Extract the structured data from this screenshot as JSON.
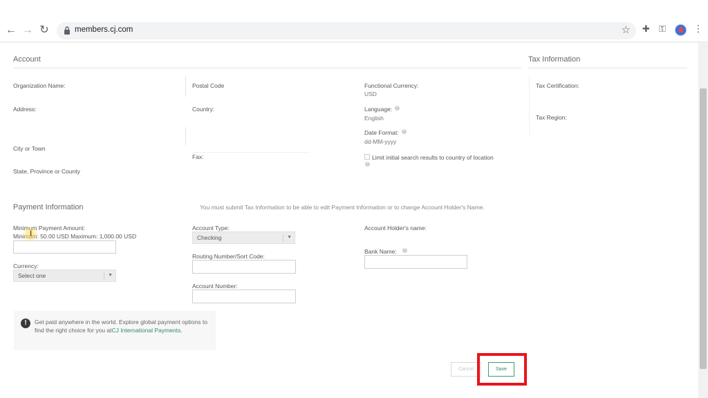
{
  "browser": {
    "url": "members.cj.com"
  },
  "account": {
    "title": "Account",
    "organization_name_label": "Organization Name:",
    "address_label": "Address:",
    "city_label": "City or Town",
    "state_label": "State, Province or County",
    "postal_code_label": "Postal Code",
    "country_label": "Country:",
    "fax_label": "Fax:",
    "functional_currency_label": "Functional Currency:",
    "functional_currency_value": "USD",
    "language_label": "Language:",
    "language_value": "English",
    "date_format_label": "Date Format:",
    "date_format_value": "dd-MM-yyyy",
    "limit_search_label": "Limit initial search results to country of location"
  },
  "tax": {
    "title": "Tax Information",
    "certification_label": "Tax Certification:",
    "region_label": "Tax Region:"
  },
  "payment": {
    "title": "Payment Information",
    "notice": "You must submit Tax Information to be able to edit Payment Information or to change Account Holder's Name.",
    "min_payment_label": "Minimum Payment Amount:",
    "min_max_hint": "Minimum: 50.00 USD Maximum: 1,000.00 USD",
    "currency_label": "Currency:",
    "currency_selected": "Select one",
    "account_type_label": "Account Type:",
    "account_type_selected": "Checking",
    "routing_label": "Routing Number/Sort Code:",
    "account_number_label": "Account Number:",
    "holder_name_label": "Account Holder's name:",
    "bank_name_label": "Bank Name:"
  },
  "info_box": {
    "text": "Get paid anywhere in the world. Explore global payment options to find the right choice for you at",
    "link": "CJ International Payments."
  },
  "actions": {
    "cancel_label": "Cancel",
    "save_label": "Save"
  },
  "help_glyph": "?",
  "icons": {
    "back": "←",
    "forward": "→",
    "reload": "↻",
    "star": "☆",
    "extensions": "✚",
    "key": "⚿",
    "menu": "⋮",
    "caret": "▼",
    "info": "!",
    "ibeam": "I"
  },
  "colors": {
    "accent": "#2e8b6b",
    "highlight": "#e8141b"
  }
}
